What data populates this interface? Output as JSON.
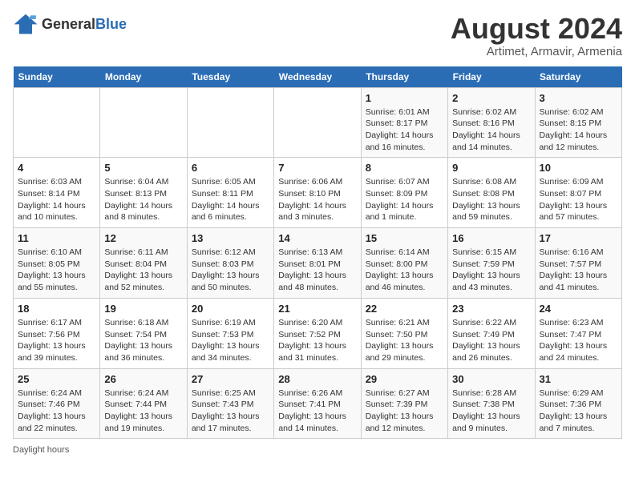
{
  "header": {
    "logo_general": "General",
    "logo_blue": "Blue",
    "title": "August 2024",
    "subtitle": "Artimet, Armavir, Armenia"
  },
  "days_of_week": [
    "Sunday",
    "Monday",
    "Tuesday",
    "Wednesday",
    "Thursday",
    "Friday",
    "Saturday"
  ],
  "footer": "Daylight hours",
  "weeks": [
    [
      {
        "day": "",
        "sunrise": "",
        "sunset": "",
        "daylight": ""
      },
      {
        "day": "",
        "sunrise": "",
        "sunset": "",
        "daylight": ""
      },
      {
        "day": "",
        "sunrise": "",
        "sunset": "",
        "daylight": ""
      },
      {
        "day": "",
        "sunrise": "",
        "sunset": "",
        "daylight": ""
      },
      {
        "day": "1",
        "sunrise": "Sunrise: 6:01 AM",
        "sunset": "Sunset: 8:17 PM",
        "daylight": "Daylight: 14 hours and 16 minutes."
      },
      {
        "day": "2",
        "sunrise": "Sunrise: 6:02 AM",
        "sunset": "Sunset: 8:16 PM",
        "daylight": "Daylight: 14 hours and 14 minutes."
      },
      {
        "day": "3",
        "sunrise": "Sunrise: 6:02 AM",
        "sunset": "Sunset: 8:15 PM",
        "daylight": "Daylight: 14 hours and 12 minutes."
      }
    ],
    [
      {
        "day": "4",
        "sunrise": "Sunrise: 6:03 AM",
        "sunset": "Sunset: 8:14 PM",
        "daylight": "Daylight: 14 hours and 10 minutes."
      },
      {
        "day": "5",
        "sunrise": "Sunrise: 6:04 AM",
        "sunset": "Sunset: 8:13 PM",
        "daylight": "Daylight: 14 hours and 8 minutes."
      },
      {
        "day": "6",
        "sunrise": "Sunrise: 6:05 AM",
        "sunset": "Sunset: 8:11 PM",
        "daylight": "Daylight: 14 hours and 6 minutes."
      },
      {
        "day": "7",
        "sunrise": "Sunrise: 6:06 AM",
        "sunset": "Sunset: 8:10 PM",
        "daylight": "Daylight: 14 hours and 3 minutes."
      },
      {
        "day": "8",
        "sunrise": "Sunrise: 6:07 AM",
        "sunset": "Sunset: 8:09 PM",
        "daylight": "Daylight: 14 hours and 1 minute."
      },
      {
        "day": "9",
        "sunrise": "Sunrise: 6:08 AM",
        "sunset": "Sunset: 8:08 PM",
        "daylight": "Daylight: 13 hours and 59 minutes."
      },
      {
        "day": "10",
        "sunrise": "Sunrise: 6:09 AM",
        "sunset": "Sunset: 8:07 PM",
        "daylight": "Daylight: 13 hours and 57 minutes."
      }
    ],
    [
      {
        "day": "11",
        "sunrise": "Sunrise: 6:10 AM",
        "sunset": "Sunset: 8:05 PM",
        "daylight": "Daylight: 13 hours and 55 minutes."
      },
      {
        "day": "12",
        "sunrise": "Sunrise: 6:11 AM",
        "sunset": "Sunset: 8:04 PM",
        "daylight": "Daylight: 13 hours and 52 minutes."
      },
      {
        "day": "13",
        "sunrise": "Sunrise: 6:12 AM",
        "sunset": "Sunset: 8:03 PM",
        "daylight": "Daylight: 13 hours and 50 minutes."
      },
      {
        "day": "14",
        "sunrise": "Sunrise: 6:13 AM",
        "sunset": "Sunset: 8:01 PM",
        "daylight": "Daylight: 13 hours and 48 minutes."
      },
      {
        "day": "15",
        "sunrise": "Sunrise: 6:14 AM",
        "sunset": "Sunset: 8:00 PM",
        "daylight": "Daylight: 13 hours and 46 minutes."
      },
      {
        "day": "16",
        "sunrise": "Sunrise: 6:15 AM",
        "sunset": "Sunset: 7:59 PM",
        "daylight": "Daylight: 13 hours and 43 minutes."
      },
      {
        "day": "17",
        "sunrise": "Sunrise: 6:16 AM",
        "sunset": "Sunset: 7:57 PM",
        "daylight": "Daylight: 13 hours and 41 minutes."
      }
    ],
    [
      {
        "day": "18",
        "sunrise": "Sunrise: 6:17 AM",
        "sunset": "Sunset: 7:56 PM",
        "daylight": "Daylight: 13 hours and 39 minutes."
      },
      {
        "day": "19",
        "sunrise": "Sunrise: 6:18 AM",
        "sunset": "Sunset: 7:54 PM",
        "daylight": "Daylight: 13 hours and 36 minutes."
      },
      {
        "day": "20",
        "sunrise": "Sunrise: 6:19 AM",
        "sunset": "Sunset: 7:53 PM",
        "daylight": "Daylight: 13 hours and 34 minutes."
      },
      {
        "day": "21",
        "sunrise": "Sunrise: 6:20 AM",
        "sunset": "Sunset: 7:52 PM",
        "daylight": "Daylight: 13 hours and 31 minutes."
      },
      {
        "day": "22",
        "sunrise": "Sunrise: 6:21 AM",
        "sunset": "Sunset: 7:50 PM",
        "daylight": "Daylight: 13 hours and 29 minutes."
      },
      {
        "day": "23",
        "sunrise": "Sunrise: 6:22 AM",
        "sunset": "Sunset: 7:49 PM",
        "daylight": "Daylight: 13 hours and 26 minutes."
      },
      {
        "day": "24",
        "sunrise": "Sunrise: 6:23 AM",
        "sunset": "Sunset: 7:47 PM",
        "daylight": "Daylight: 13 hours and 24 minutes."
      }
    ],
    [
      {
        "day": "25",
        "sunrise": "Sunrise: 6:24 AM",
        "sunset": "Sunset: 7:46 PM",
        "daylight": "Daylight: 13 hours and 22 minutes."
      },
      {
        "day": "26",
        "sunrise": "Sunrise: 6:24 AM",
        "sunset": "Sunset: 7:44 PM",
        "daylight": "Daylight: 13 hours and 19 minutes."
      },
      {
        "day": "27",
        "sunrise": "Sunrise: 6:25 AM",
        "sunset": "Sunset: 7:43 PM",
        "daylight": "Daylight: 13 hours and 17 minutes."
      },
      {
        "day": "28",
        "sunrise": "Sunrise: 6:26 AM",
        "sunset": "Sunset: 7:41 PM",
        "daylight": "Daylight: 13 hours and 14 minutes."
      },
      {
        "day": "29",
        "sunrise": "Sunrise: 6:27 AM",
        "sunset": "Sunset: 7:39 PM",
        "daylight": "Daylight: 13 hours and 12 minutes."
      },
      {
        "day": "30",
        "sunrise": "Sunrise: 6:28 AM",
        "sunset": "Sunset: 7:38 PM",
        "daylight": "Daylight: 13 hours and 9 minutes."
      },
      {
        "day": "31",
        "sunrise": "Sunrise: 6:29 AM",
        "sunset": "Sunset: 7:36 PM",
        "daylight": "Daylight: 13 hours and 7 minutes."
      }
    ]
  ]
}
